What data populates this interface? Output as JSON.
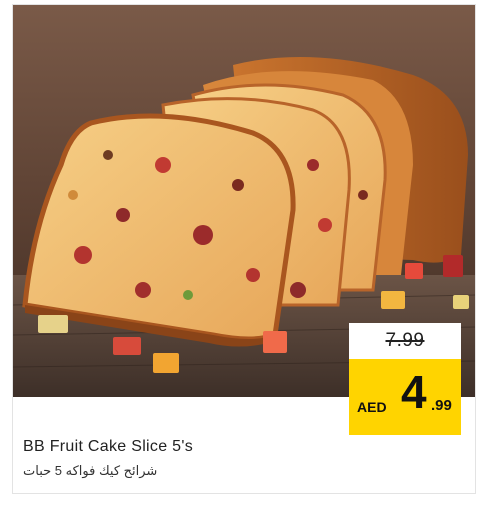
{
  "product": {
    "title": "BB Fruit Cake Slice 5's",
    "title_ar": "شرائح كيك فواكه 5 حبات",
    "image_alt": "fruit-cake-slices-photo"
  },
  "price": {
    "old": "7.99",
    "currency": "AED",
    "new_integer": "4",
    "new_decimal": ".99"
  },
  "colors": {
    "price_highlight": "#ffd400",
    "card_border": "#e3e3e3"
  }
}
